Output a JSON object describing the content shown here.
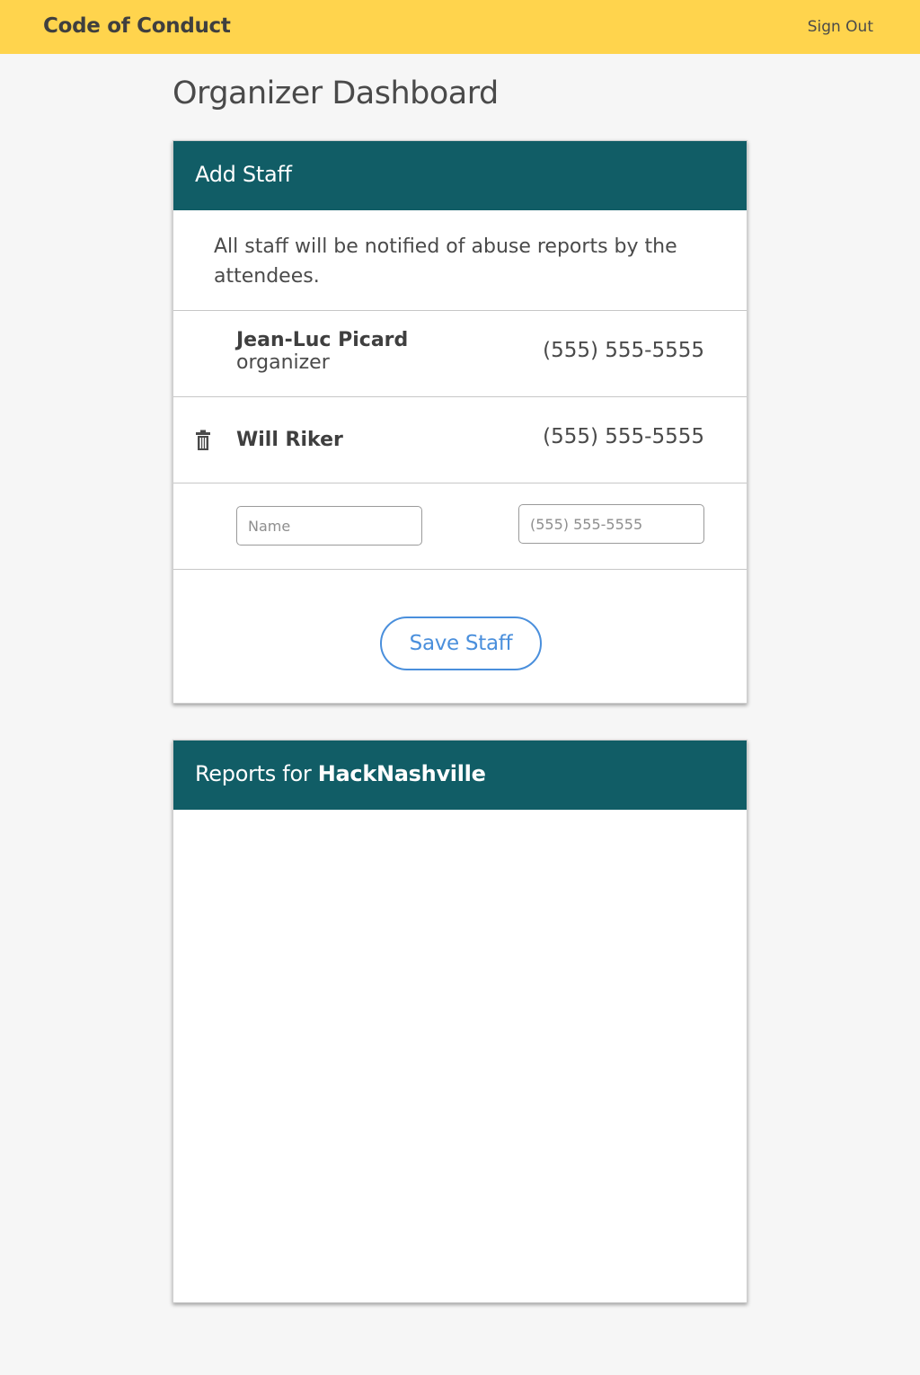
{
  "topbar": {
    "brand": "Code of Conduct",
    "sign_out": "Sign Out"
  },
  "page": {
    "title": "Organizer Dashboard"
  },
  "staff_card": {
    "header": "Add Staff",
    "notice": "All staff will be notified of abuse reports by the attendees.",
    "members": [
      {
        "name": "Jean-Luc Picard",
        "role": "organizer",
        "phone": "(555) 555-5555"
      },
      {
        "name": "Will Riker",
        "role": "",
        "phone": "(555) 555-5555"
      }
    ],
    "new_staff": {
      "name_placeholder": "Name",
      "phone_placeholder": "(555) 555-5555"
    },
    "save_label": "Save Staff"
  },
  "reports_card": {
    "header_prefix": "Reports for ",
    "event_name": "HackNashville"
  },
  "icons": {
    "trash": "trash-icon"
  },
  "colors": {
    "topbar": "#ffd44d",
    "card_header": "#115d66",
    "accent": "#4a8fdc",
    "background": "#f6f6f6"
  }
}
